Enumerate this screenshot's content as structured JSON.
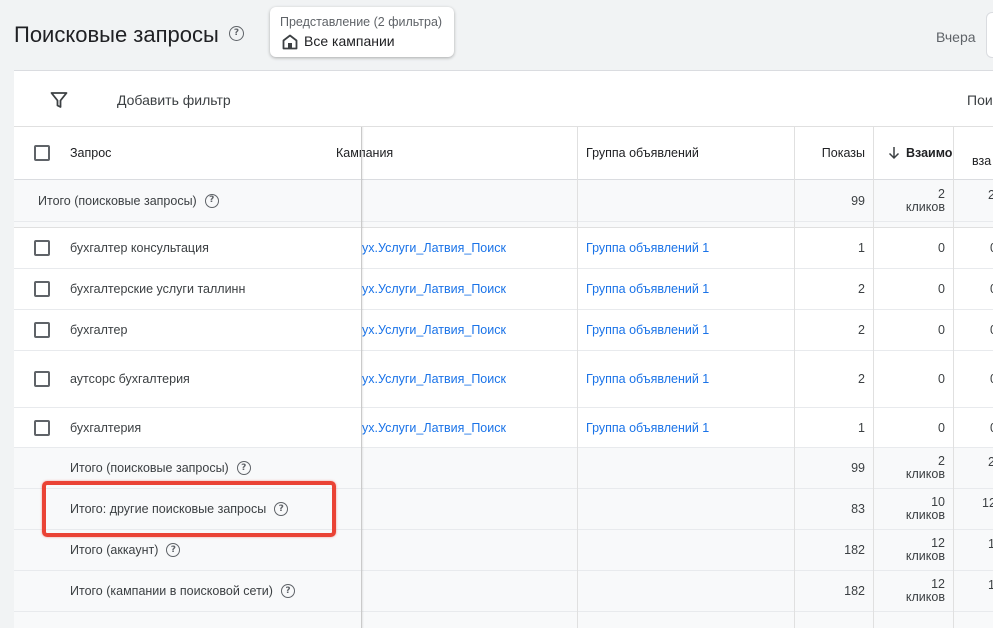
{
  "header": {
    "title": "Поисковые запросы",
    "view_label": "Представление (2 фильтра)",
    "view_value": "Все кампании",
    "date_label": "Вчера"
  },
  "toolbar": {
    "add_filter": "Добавить фильтр",
    "search_partial": "Пои"
  },
  "table": {
    "columns": {
      "query": "Запрос",
      "campaign": "Кампания",
      "ad_group": "Группа объявлений",
      "impressions": "Показы",
      "interactions": "Взаимо",
      "next": "вза"
    },
    "top_total": {
      "label": "Итого (поисковые запросы)",
      "impressions": "99",
      "int_num": "2",
      "int_unit": "кликов",
      "next": "2"
    },
    "rows": [
      {
        "query": "бухгалтер консультация",
        "campaign": "ух.Услуги_Латвия_Поиск",
        "ad_group": "Группа объявлений 1",
        "impressions": "1",
        "interactions": "0",
        "next": "0"
      },
      {
        "query": "бухгалтерские услуги таллинн",
        "campaign": "ух.Услуги_Латвия_Поиск",
        "ad_group": "Группа объявлений 1",
        "impressions": "2",
        "interactions": "0",
        "next": "0"
      },
      {
        "query": "бухгалтер",
        "campaign": "ух.Услуги_Латвия_Поиск",
        "ad_group": "Группа объявлений 1",
        "impressions": "2",
        "interactions": "0",
        "next": "0"
      },
      {
        "query": "аутсорс бухгалтерия",
        "campaign": "ух.Услуги_Латвия_Поиск",
        "ad_group": "Группа объявлений 1",
        "impressions": "2",
        "interactions": "0",
        "next": "0"
      },
      {
        "query": "бухгалтерия",
        "campaign": "ух.Услуги_Латвия_Поиск",
        "ad_group": "Группа объявлений 1",
        "impressions": "1",
        "interactions": "0",
        "next": "0"
      }
    ],
    "totals": [
      {
        "label": "Итого (поисковые запросы)",
        "impressions": "99",
        "int_num": "2",
        "int_unit": "кликов",
        "next": "2"
      },
      {
        "label": "Итого: другие поисковые запросы",
        "impressions": "83",
        "int_num": "10",
        "int_unit": "кликов",
        "next": "12"
      },
      {
        "label": "Итого (аккаунт)",
        "impressions": "182",
        "int_num": "12",
        "int_unit": "кликов",
        "next": "1"
      },
      {
        "label": "Итого (кампании в поисковой сети)",
        "impressions": "182",
        "int_num": "12",
        "int_unit": "кликов",
        "next": "1"
      }
    ]
  },
  "colors": {
    "accent": "#1a73e8",
    "highlight": "#ea4335"
  }
}
